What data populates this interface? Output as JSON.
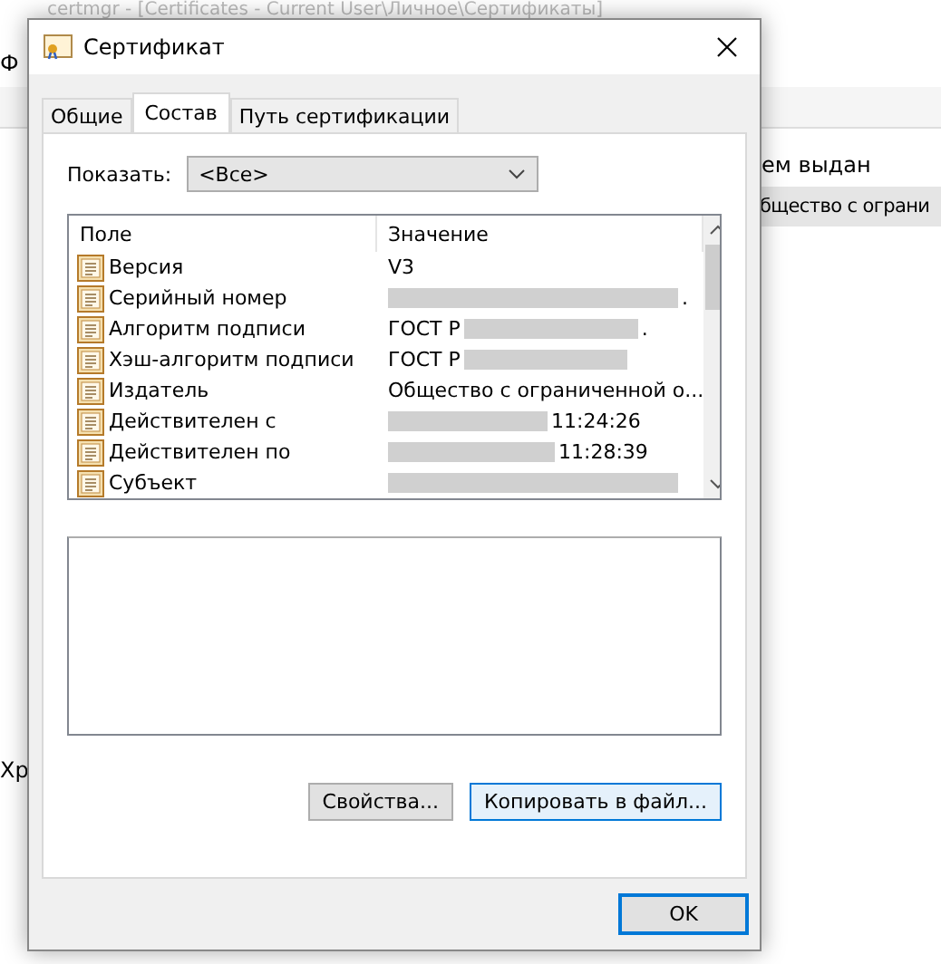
{
  "background_window": {
    "title": "certmgr - [Certificates - Current User\\Личное\\Сертификаты]",
    "menu_fragment": "Ф",
    "column_header_fragment": "ем выдан",
    "cell_fragment": "бщество с ограни",
    "status_fragment": "Хр"
  },
  "dialog": {
    "title": "Сертификат"
  },
  "tabs": [
    {
      "label": "Общие",
      "selected": false
    },
    {
      "label": "Состав",
      "selected": true
    },
    {
      "label": "Путь сертификации",
      "selected": false
    }
  ],
  "show": {
    "label": "Показать:",
    "value": "<Все>"
  },
  "table": {
    "columns": [
      "Поле",
      "Значение"
    ],
    "rows": [
      {
        "field": "Версия",
        "value": "V3",
        "kind": "plain"
      },
      {
        "field": "Серийный номер",
        "value": ".",
        "kind": "masked_start"
      },
      {
        "field": "Алгоритм подписи",
        "value": "ГОСТ Р",
        "kind": "masked_end",
        "tail": "."
      },
      {
        "field": "Хэш-алгоритм подписи",
        "value": "ГОСТ Р",
        "kind": "masked_end"
      },
      {
        "field": "Издатель",
        "value": "Общество с ограниченной о...",
        "kind": "plain"
      },
      {
        "field": "Действителен с",
        "value": "11:24:26",
        "kind": "masked_start"
      },
      {
        "field": "Действителен по",
        "value": "11:28:39",
        "kind": "masked_start"
      },
      {
        "field": "Субъект",
        "kind": "masked"
      }
    ]
  },
  "buttons": [
    {
      "label": "Свойства...",
      "kind": "normal"
    },
    {
      "label": "Копировать в файл...",
      "kind": "focused"
    }
  ],
  "ok": {
    "label": "OK"
  }
}
